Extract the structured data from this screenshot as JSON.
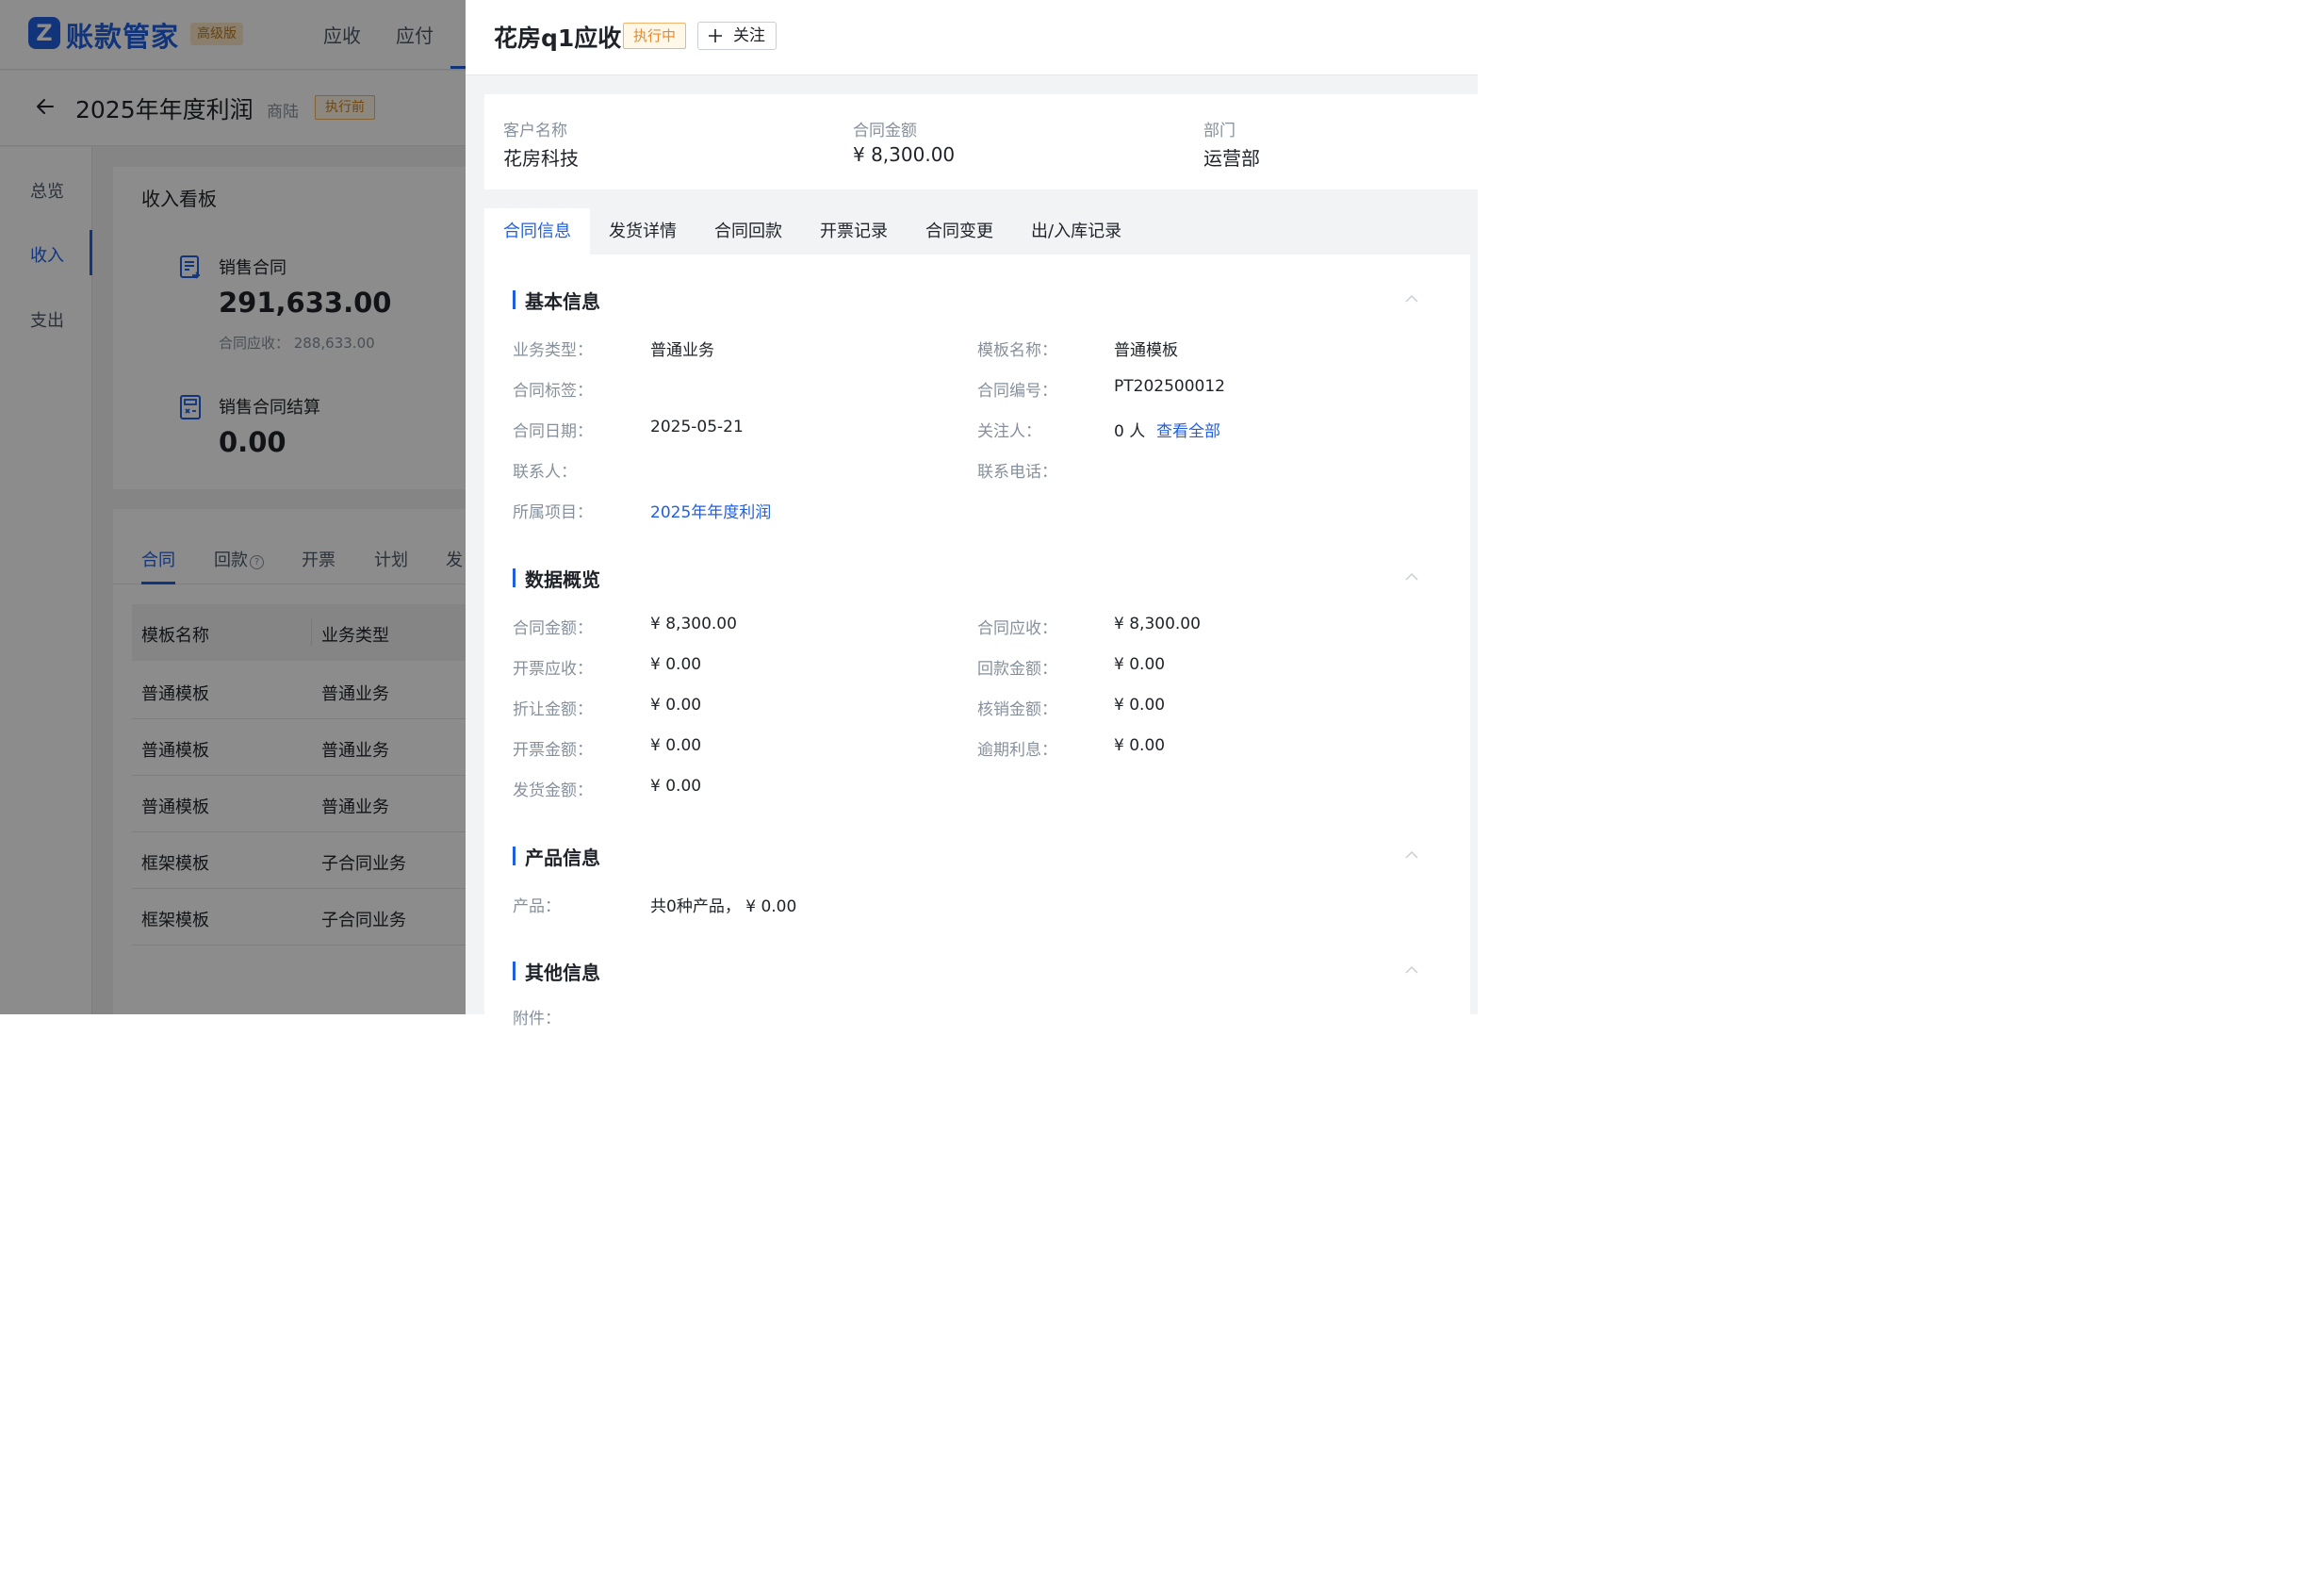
{
  "app": {
    "logo_glyph": "Z",
    "name": "账款管家",
    "edition": "高级版",
    "nav": [
      "应收",
      "应付"
    ]
  },
  "project": {
    "title": "2025年年度利润",
    "owner": "商陆",
    "status": "执行前"
  },
  "leftnav": [
    "总览",
    "收入",
    "支出"
  ],
  "board": {
    "title": "收入看板",
    "sales_contract_label": "销售合同",
    "sales_contract_value": "291,633.00",
    "receivable_text": "合同应收：  288,633.00",
    "settlement_label": "销售合同结算",
    "settlement_value": "0.00"
  },
  "list": {
    "tabs": [
      "合同",
      "回款",
      "开票",
      "计划",
      "发"
    ],
    "help_glyph": "?",
    "columns": [
      "模板名称",
      "业务类型"
    ],
    "rows": [
      [
        "普通模板",
        "普通业务"
      ],
      [
        "普通模板",
        "普通业务"
      ],
      [
        "普通模板",
        "普通业务"
      ],
      [
        "框架模板",
        "子合同业务"
      ],
      [
        "框架模板",
        "子合同业务"
      ]
    ]
  },
  "drawer": {
    "title": "花房q1应收",
    "status": "执行中",
    "follow_label": "关注",
    "summary": [
      {
        "label": "客户名称",
        "value": "花房科技"
      },
      {
        "label": "合同金额",
        "value": "¥ 8,300.00"
      },
      {
        "label": "部门",
        "value": "运营部"
      }
    ],
    "tabs": [
      "合同信息",
      "发货详情",
      "合同回款",
      "开票记录",
      "合同变更",
      "出/入库记录"
    ],
    "basic": {
      "title": "基本信息",
      "business_type_label": "业务类型：",
      "business_type": "普通业务",
      "template_label": "模板名称：",
      "template": "普通模板",
      "tag_label": "合同标签：",
      "number_label": "合同编号：",
      "number": "PT202500012",
      "date_label": "合同日期：",
      "date": "2025-05-21",
      "followers_label": "关注人：",
      "followers": "0 人",
      "view_all": "查看全部",
      "contact_label": "联系人：",
      "phone_label": "联系电话：",
      "project_label": "所属项目：",
      "project": "2025年年度利润"
    },
    "overview": {
      "title": "数据概览",
      "rows": [
        {
          "l1": "合同金额：",
          "v1": "¥ 8,300.00",
          "l2": "合同应收：",
          "v2": "¥ 8,300.00"
        },
        {
          "l1": "开票应收：",
          "v1": "¥ 0.00",
          "l2": "回款金额：",
          "v2": "¥ 0.00"
        },
        {
          "l1": "折让金额：",
          "v1": "¥ 0.00",
          "l2": "核销金额：",
          "v2": "¥ 0.00"
        },
        {
          "l1": "开票金额：",
          "v1": "¥ 0.00",
          "l2": "逾期利息：",
          "v2": "¥ 0.00"
        },
        {
          "l1": "发货金额：",
          "v1": "¥ 0.00"
        }
      ]
    },
    "product": {
      "title": "产品信息",
      "label": "产品：",
      "value": "共0种产品， ¥ 0.00"
    },
    "other": {
      "title": "其他信息",
      "attachment_label": "附件："
    }
  },
  "colors": {
    "accent": "#1f5fe0",
    "warning": "#e8892b"
  }
}
